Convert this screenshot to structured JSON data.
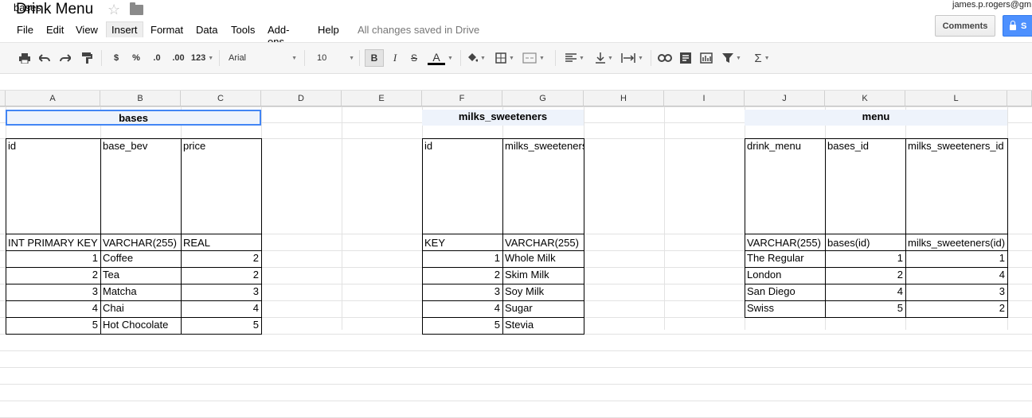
{
  "app": {
    "doc_title": "Drink Menu",
    "user_email": "james.p.rogers@gm",
    "comments_label": "Comments",
    "share_label": "S",
    "save_status": "All changes saved in Drive"
  },
  "menu": {
    "items": [
      "File",
      "Edit",
      "View",
      "Insert",
      "Format",
      "Data",
      "Tools",
      "Add-ons",
      "Help"
    ]
  },
  "toolbar": {
    "currency": "$",
    "percent": "%",
    "dec_less": ".0",
    "dec_more": ".00",
    "more_formats": "123",
    "font": "Arial",
    "font_size": "10",
    "bold": "B",
    "italic": "I",
    "strike": "S",
    "text_color": "A"
  },
  "formula_bar": {
    "content": "bases"
  },
  "columns": [
    "A",
    "B",
    "C",
    "D",
    "E",
    "F",
    "G",
    "H",
    "I",
    "J",
    "K",
    "L"
  ],
  "tables": {
    "bases": {
      "title": "bases",
      "headers": [
        "id",
        "base_bev",
        "price"
      ],
      "types": [
        "INT PRIMARY KEY",
        "VARCHAR(255)",
        "REAL"
      ],
      "rows": [
        [
          "1",
          "Coffee",
          "2"
        ],
        [
          "2",
          "Tea",
          "2"
        ],
        [
          "3",
          "Matcha",
          "3"
        ],
        [
          "4",
          "Chai",
          "4"
        ],
        [
          "5",
          "Hot Chocolate",
          "5"
        ]
      ]
    },
    "milks": {
      "title": "milks_sweeteners",
      "headers": [
        "id",
        "milks_sweeteners"
      ],
      "types": [
        "INT PRIMARY KEY",
        "VARCHAR(255)"
      ],
      "rows": [
        [
          "1",
          "Whole Milk"
        ],
        [
          "2",
          "Skim Milk"
        ],
        [
          "3",
          "Soy Milk"
        ],
        [
          "4",
          "Sugar"
        ],
        [
          "5",
          "Stevia"
        ]
      ]
    },
    "menu": {
      "title": "menu",
      "headers": [
        "drink_menu",
        "bases_id",
        "milks_sweeteners_id"
      ],
      "types": [
        "VARCHAR(255)",
        "INT, FOREIGN KEY (bases_id) REFERENCES bases(id)",
        "INT, FOREIGN KEY (milks_sweeteners_id) REFERENCES milks_sweeteners(id)"
      ],
      "rows": [
        [
          "The Regular",
          "1",
          "1"
        ],
        [
          "London",
          "2",
          "4"
        ],
        [
          "San Diego",
          "4",
          "3"
        ],
        [
          "Swiss",
          "5",
          "2"
        ]
      ]
    }
  },
  "colors": {
    "accent": "#4d90fe",
    "selection": "#4285f4",
    "header_fill": "#eef3fb"
  }
}
